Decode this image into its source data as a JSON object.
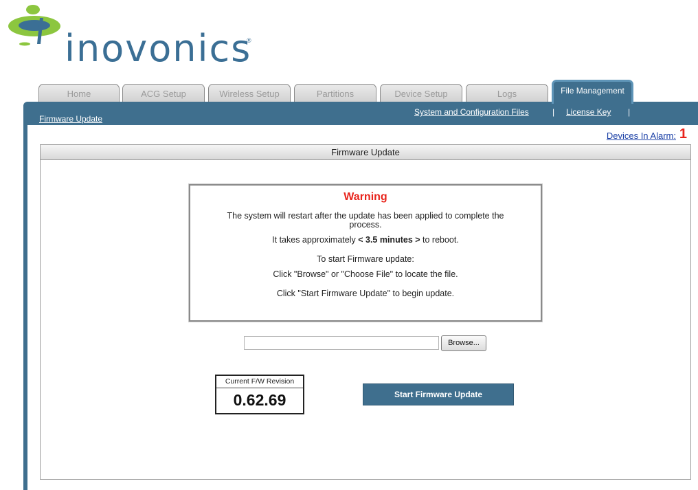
{
  "brand": {
    "name": "inovonics",
    "registered": "®"
  },
  "tabs": [
    {
      "label": "Home",
      "active": false
    },
    {
      "label": "ACG Setup",
      "active": false
    },
    {
      "label": "Wireless Setup",
      "active": false
    },
    {
      "label": "Partitions",
      "active": false
    },
    {
      "label": "Device Setup",
      "active": false
    },
    {
      "label": "Logs",
      "active": false
    },
    {
      "label": "File Management",
      "active": true
    }
  ],
  "subnav": {
    "current": "Firmware Update",
    "links": [
      "System and Configuration Files",
      "License Key"
    ],
    "separator": "|"
  },
  "alarm": {
    "label": "Devices In Alarm:",
    "count": "1"
  },
  "panel": {
    "title": "Firmware Update"
  },
  "warning": {
    "title": "Warning",
    "line1": "The system will restart after the update has been applied to complete the process.",
    "line2_prefix": "It takes approximately ",
    "line2_bold": "< 3.5 minutes >",
    "line2_suffix": " to reboot.",
    "line3": "To start Firmware update:",
    "line4": "Click \"Browse\" or \"Choose File\" to locate the file.",
    "line5": "Click \"Start Firmware Update\" to begin update."
  },
  "file_input": {
    "value": "",
    "browse_label": "Browse..."
  },
  "revision": {
    "label": "Current F/W Revision",
    "value": "0.62.69"
  },
  "start_button": {
    "label": "Start Firmware Update"
  },
  "colors": {
    "brand_blue": "#3f6f8e",
    "logo_green": "#8cc63f",
    "alarm_red": "#e8231b"
  }
}
